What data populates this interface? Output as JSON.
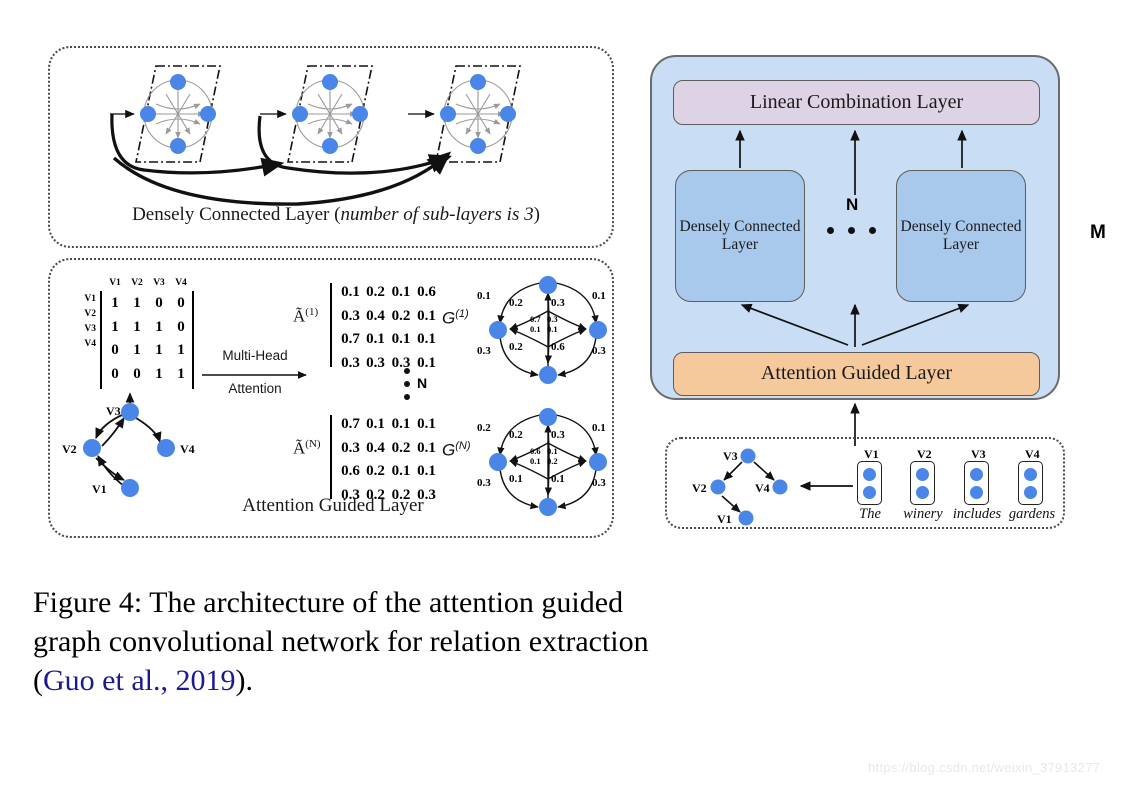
{
  "figure": {
    "caption_line1": "Figure 4:  The  architecture  of  the  attention  guided",
    "caption_line2": "graph  convolutional  network  for  relation  extraction",
    "caption_line3_prefix": "(",
    "caption_citation": "Guo et al., 2019",
    "caption_line3_suffix": ")."
  },
  "watermark": {
    "text": "https://blog.csdn.net/weixin_37913277"
  },
  "left_panel": {
    "dcl_block": {
      "caption_plain": "Densely Connected Layer (",
      "caption_italic": "number of sub-layers is 3",
      "caption_close": ")",
      "sublayer_count": 3
    },
    "agl_block": {
      "caption": "Attention Guided Layer",
      "adjacency": {
        "col_headers": [
          "V1",
          "V2",
          "V3",
          "V4"
        ],
        "row_headers": [
          "V1",
          "V2",
          "V3",
          "V4"
        ],
        "rows": [
          [
            "1",
            "1",
            "0",
            "0"
          ],
          [
            "1",
            "1",
            "1",
            "0"
          ],
          [
            "0",
            "1",
            "1",
            "1"
          ],
          [
            "0",
            "0",
            "1",
            "1"
          ]
        ]
      },
      "transform": {
        "line1": "Multi-Head",
        "line2": "Attention"
      },
      "attention_matrices": [
        {
          "label": "Ã",
          "sup": "(1)",
          "rows": [
            [
              "0.1",
              "0.2",
              "0.1",
              "0.6"
            ],
            [
              "0.3",
              "0.4",
              "0.2",
              "0.1"
            ],
            [
              "0.7",
              "0.1",
              "0.1",
              "0.1"
            ],
            [
              "0.3",
              "0.3",
              "0.3",
              "0.1"
            ]
          ]
        },
        {
          "label": "Ã",
          "sup": "(N)",
          "rows": [
            [
              "0.7",
              "0.1",
              "0.1",
              "0.1"
            ],
            [
              "0.3",
              "0.4",
              "0.2",
              "0.1"
            ],
            [
              "0.6",
              "0.2",
              "0.1",
              "0.1"
            ],
            [
              "0.3",
              "0.2",
              "0.2",
              "0.3"
            ]
          ]
        }
      ],
      "graphs": [
        {
          "label": "G",
          "sup": "(1)",
          "outer_weights": {
            "top_left": "0.1",
            "top_right": "0.1",
            "bottom_left": "0.3",
            "bottom_right": "0.3"
          },
          "inner_weights": {
            "upper_left": "0.2",
            "upper_right": "0.3",
            "lower_left": "0.2",
            "lower_right": "0.6"
          },
          "center_weights": {
            "tl": "0.7",
            "tr": "0.3",
            "bl": "0.1",
            "br": "0.1"
          }
        },
        {
          "label": "G",
          "sup": "(N)",
          "outer_weights": {
            "top_left": "0.2",
            "top_right": "0.1",
            "bottom_left": "0.3",
            "bottom_right": "0.3"
          },
          "inner_weights": {
            "upper_left": "0.2",
            "upper_right": "0.3",
            "lower_left": "0.1",
            "lower_right": "0.1"
          },
          "center_weights": {
            "tl": "0.6",
            "tr": "0.1",
            "bl": "0.1",
            "br": "0.2"
          }
        }
      ],
      "repeat_label": "N",
      "dep_graph_vertices": [
        "V1",
        "V2",
        "V3",
        "V4"
      ]
    }
  },
  "right_panel": {
    "outer_label": "M",
    "repeat_label": "N",
    "linear_combination": "Linear Combination Layer",
    "dcl_left": "Densely Connected\nLayer",
    "dcl_right": "Densely Connected\nLayer",
    "dcl_left_line1": "Densely Connected",
    "dcl_left_line2": "Layer",
    "dcl_right_line1": "Densely Connected",
    "dcl_right_line2": "Layer",
    "attention_guided": "Attention Guided Layer",
    "input_block": {
      "vertices": [
        "V1",
        "V2",
        "V3",
        "V4"
      ],
      "tokens": [
        "The",
        "winery",
        "includes",
        "gardens"
      ],
      "token_vertex_labels": [
        "V1",
        "V2",
        "V3",
        "V4"
      ]
    }
  }
}
